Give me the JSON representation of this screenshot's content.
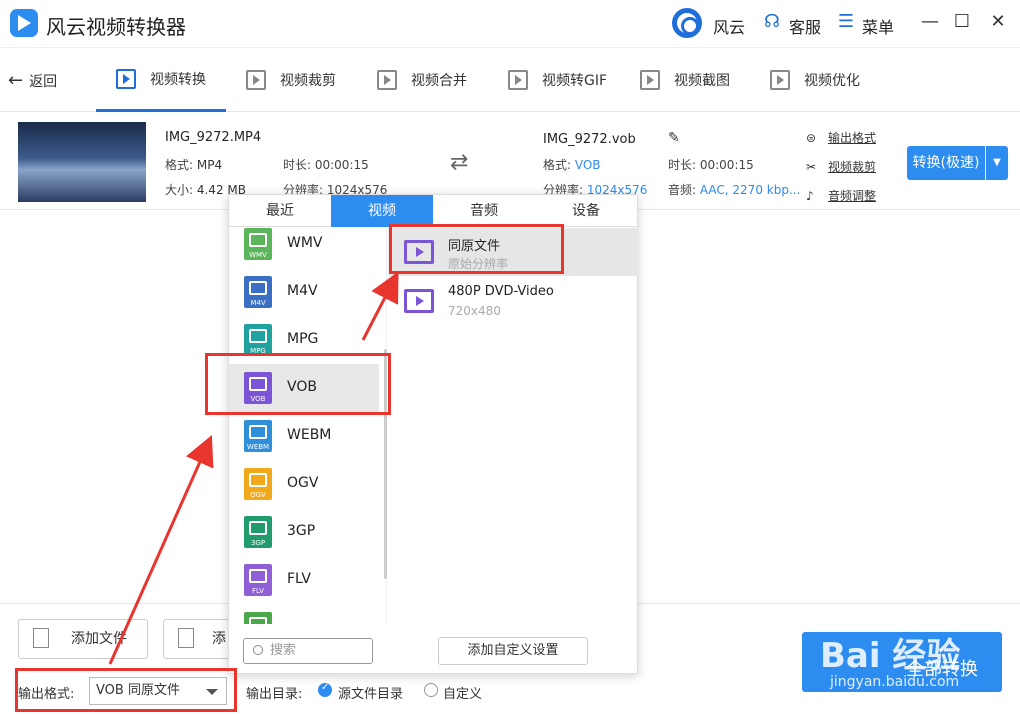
{
  "app": {
    "title": "风云视频转换器",
    "brand_label": "风云",
    "service_label": "客服",
    "menu_label": "菜单"
  },
  "nav": {
    "back_label": "返回",
    "tabs": [
      {
        "label": "视频转换",
        "active": true
      },
      {
        "label": "视频裁剪"
      },
      {
        "label": "视频合并"
      },
      {
        "label": "视频转GIF"
      },
      {
        "label": "视频截图"
      },
      {
        "label": "视频优化"
      }
    ]
  },
  "file": {
    "source_name": "IMG_9272.MP4",
    "format_label": "格式: ",
    "format": "MP4",
    "size_label": "大小: ",
    "size": "4.42 MB",
    "duration_label": "时长: ",
    "duration": "00:00:15",
    "resolution_label": "分辨率: ",
    "resolution": "1024x576",
    "output_name": "IMG_9272.vob",
    "out_format": "VOB",
    "out_duration": "00:00:15",
    "out_resolution": "1024x576",
    "audio_label": "音频: ",
    "audio": "AAC, 2270 kbp...",
    "links": [
      "输出格式",
      "视频裁剪",
      "音频调整"
    ],
    "convert_label": "转换(极速)"
  },
  "popup": {
    "tabs": [
      "最近",
      "视频",
      "音频",
      "设备"
    ],
    "active_tab": "视频",
    "formats": [
      {
        "name": "WMV",
        "tag": "WMV",
        "color": "#5bb55b"
      },
      {
        "name": "M4V",
        "tag": "M4V",
        "color": "#3a6fc4"
      },
      {
        "name": "MPG",
        "tag": "MPG",
        "color": "#20a39e"
      },
      {
        "name": "VOB",
        "tag": "VOB",
        "color": "#7c54d6",
        "selected": true
      },
      {
        "name": "WEBM",
        "tag": "WEBM",
        "color": "#2f8fd8"
      },
      {
        "name": "OGV",
        "tag": "OGV",
        "color": "#f2a81b"
      },
      {
        "name": "3GP",
        "tag": "3GP",
        "color": "#1f9b6c"
      },
      {
        "name": "FLV",
        "tag": "FLV",
        "color": "#8f5fd6"
      },
      {
        "name": "",
        "tag": "",
        "color": "#4aa84a"
      }
    ],
    "presets": [
      {
        "title": "同原文件",
        "subtitle": "原始分辨率",
        "selected": true
      },
      {
        "title": "480P DVD-Video",
        "subtitle": "720x480"
      }
    ],
    "search_placeholder": "搜索",
    "custom_label": "添加自定义设置"
  },
  "bottom": {
    "add_file_label": "添加文件",
    "add_folder_label": "添",
    "output_format_label": "输出格式:",
    "output_format_value": "VOB 同原文件",
    "output_dir_label": "输出目录:",
    "radio_source": "源文件目录",
    "radio_custom": "自定义",
    "convert_all_label": "全部转换",
    "watermark": "Bai 经验",
    "watermark_url": "jingyan.baidu.com"
  }
}
